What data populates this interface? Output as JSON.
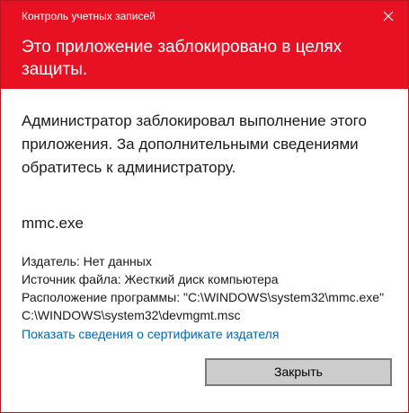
{
  "window": {
    "title": "Контроль учетных записей"
  },
  "header": {
    "headline": "Это приложение заблокировано в целях защиты."
  },
  "body": {
    "message": "Администратор заблокировал выполнение этого приложения. За дополнительными сведениями обратитесь к администратору.",
    "program_name": "mmc.exe",
    "publisher": "Издатель: Нет данных",
    "file_origin": "Источник файла: Жесткий диск компьютера",
    "program_location": "Расположение программы: \"C:\\WINDOWS\\system32\\mmc.exe\" C:\\WINDOWS\\system32\\devmgmt.msc",
    "certificate_link": "Показать сведения о сертификате издателя"
  },
  "buttons": {
    "close_label": "Закрыть"
  },
  "icons": {
    "close": "close-icon"
  },
  "colors": {
    "header_background": "#e81123",
    "link": "#0067b8",
    "button_background": "#cccccc",
    "button_border": "#7a7a7a"
  }
}
